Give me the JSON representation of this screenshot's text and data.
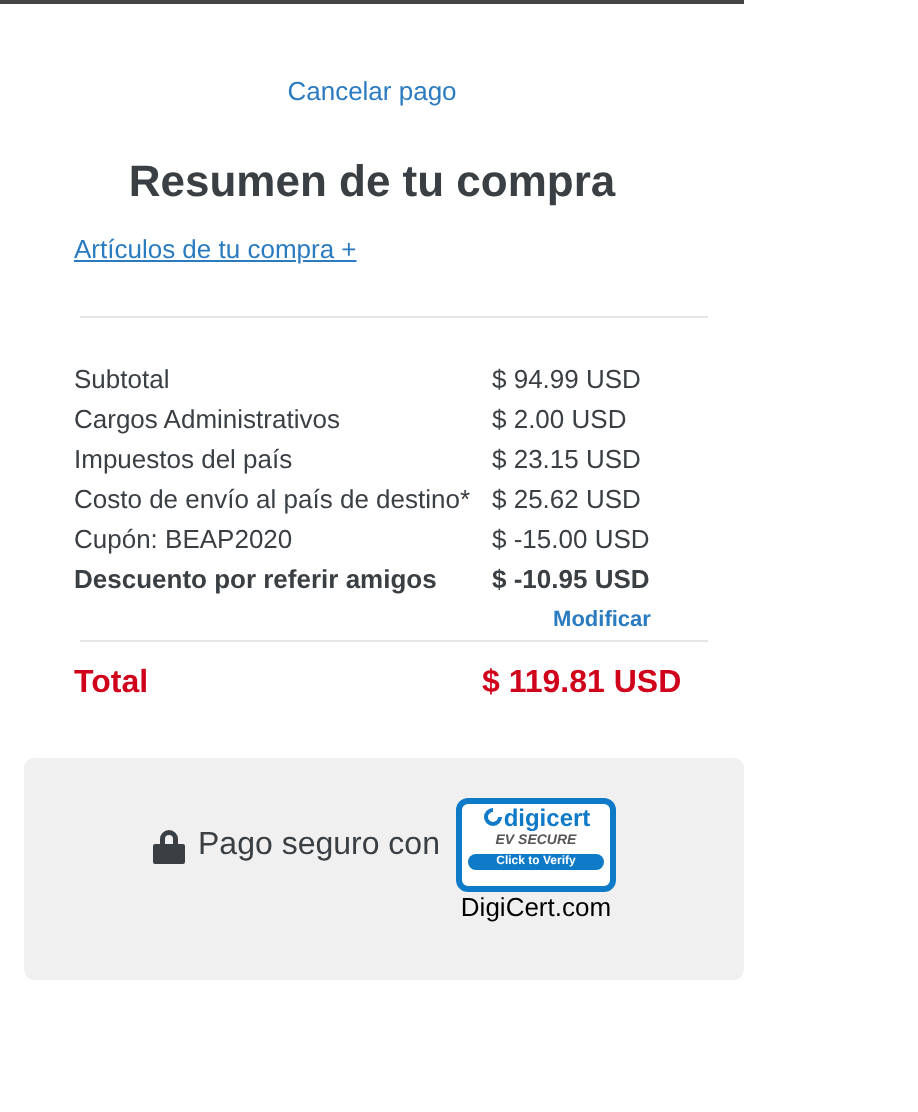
{
  "cancel_link": "Cancelar pago",
  "title": "Resumen de tu compra",
  "items_link": "Artículos de tu compra +",
  "rows": [
    {
      "label": "Subtotal",
      "value": "$ 94.99 USD",
      "bold": false
    },
    {
      "label": "Cargos Administrativos",
      "value": "$ 2.00 USD",
      "bold": false
    },
    {
      "label": "Impuestos del país",
      "value": "$ 23.15 USD",
      "bold": false
    },
    {
      "label": "Costo de envío al país de destino*",
      "value": "$ 25.62 USD",
      "bold": false
    },
    {
      "label": "Cupón: BEAP2020",
      "value": "$ -15.00 USD",
      "bold": false
    },
    {
      "label": "Descuento por referir amigos",
      "value": "$ -10.95 USD",
      "bold": true,
      "action": "Modificar"
    }
  ],
  "total": {
    "label": "Total",
    "value": "$ 119.81 USD"
  },
  "secure": {
    "text": "Pago seguro con",
    "badge": {
      "brand": "digicert",
      "level": "EV SECURE",
      "button": "Click to Verify"
    },
    "caption": "DigiCert.com"
  }
}
